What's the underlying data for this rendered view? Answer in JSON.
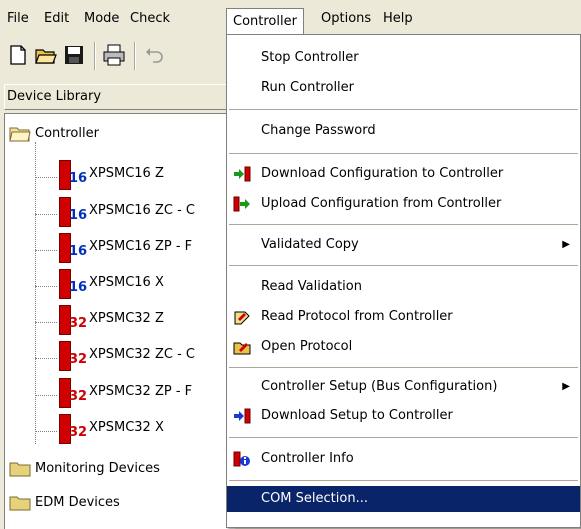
{
  "menubar": {
    "items": [
      {
        "label": "File"
      },
      {
        "label": "Edit"
      },
      {
        "label": "Mode"
      },
      {
        "label": "Check"
      },
      {
        "label": "Controller"
      },
      {
        "label": "Options"
      },
      {
        "label": "Help"
      }
    ]
  },
  "toolbar": {
    "icons": [
      "new-document-icon",
      "open-folder-icon",
      "save-icon",
      "print-icon",
      "undo-icon"
    ]
  },
  "library": {
    "header": "Device Library",
    "controller_folder": "Controller",
    "devices": [
      {
        "label": "XPSMC16 Z",
        "badge": "16",
        "badge_color": "#0030c0"
      },
      {
        "label": "XPSMC16 ZC - C",
        "badge": "16",
        "badge_color": "#0030c0"
      },
      {
        "label": "XPSMC16 ZP - F",
        "badge": "16",
        "badge_color": "#0030c0"
      },
      {
        "label": "XPSMC16 X",
        "badge": "16",
        "badge_color": "#0030c0"
      },
      {
        "label": "XPSMC32 Z",
        "badge": "32",
        "badge_color": "#d00000"
      },
      {
        "label": "XPSMC32 ZC - C",
        "badge": "32",
        "badge_color": "#d00000"
      },
      {
        "label": "XPSMC32 ZP - F",
        "badge": "32",
        "badge_color": "#d00000"
      },
      {
        "label": "XPSMC32 X",
        "badge": "32",
        "badge_color": "#d00000"
      }
    ],
    "folders": [
      {
        "label": "Monitoring Devices"
      },
      {
        "label": "EDM Devices"
      }
    ]
  },
  "controller_menu": {
    "stop": "Stop Controller",
    "run": "Run Controller",
    "change_password": "Change Password",
    "download_config": "Download Configuration to Controller",
    "upload_config": "Upload Configuration from Controller",
    "validated_copy": "Validated Copy",
    "read_validation": "Read Validation",
    "read_protocol": "Read Protocol from Controller",
    "open_protocol": "Open Protocol",
    "controller_setup": "Controller Setup (Bus Configuration)",
    "download_setup": "Download Setup to Controller",
    "controller_info": "Controller Info",
    "com_selection": "COM Selection..."
  },
  "colors": {
    "selection": "#0a246a",
    "chrome": "#ece9d8"
  }
}
